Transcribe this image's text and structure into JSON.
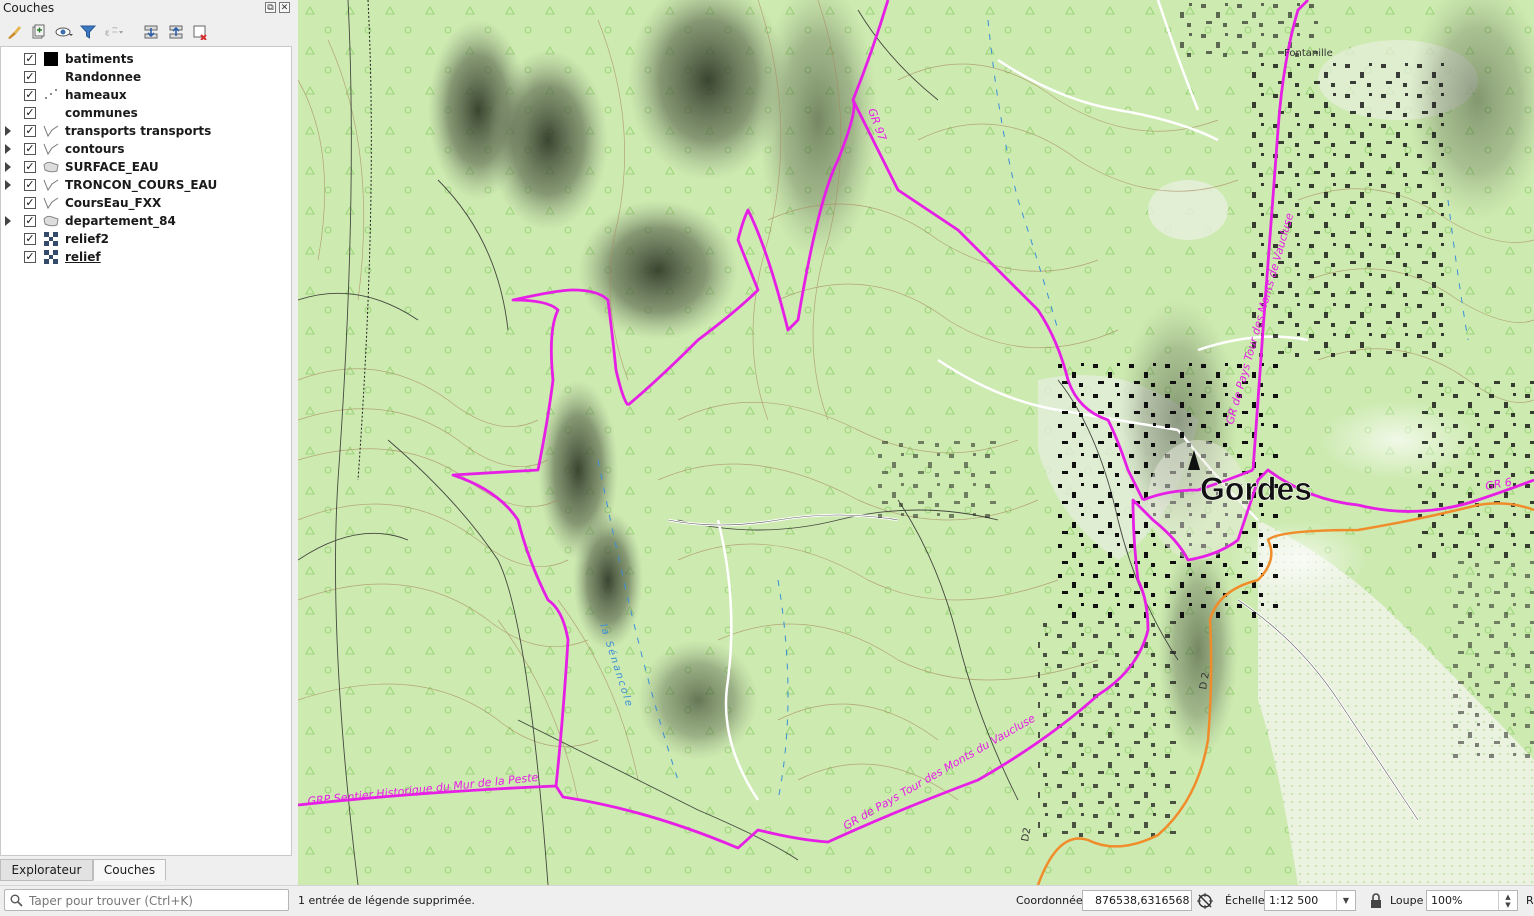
{
  "dock": {
    "title": "Couches",
    "float_glyph": "⧉",
    "close_glyph": "✕"
  },
  "toolbar": {
    "buttons": [
      "open-layer-styling-icon",
      "add-group-icon",
      "manage-map-themes-icon",
      "filter-legend-icon",
      "expression-filter-icon",
      "expand-all-icon",
      "collapse-all-icon",
      "remove-layer-icon"
    ]
  },
  "layers": [
    {
      "label": "batiments",
      "checked": true,
      "symbol": "fill-black",
      "expandable": false
    },
    {
      "label": "Randonnee",
      "checked": true,
      "symbol": "none",
      "expandable": false
    },
    {
      "label": "hameaux",
      "checked": true,
      "symbol": "points",
      "expandable": false
    },
    {
      "label": "communes",
      "checked": true,
      "symbol": "none",
      "expandable": false
    },
    {
      "label": "transports transports",
      "checked": true,
      "symbol": "line",
      "expandable": true
    },
    {
      "label": "contours",
      "checked": true,
      "symbol": "line",
      "expandable": true
    },
    {
      "label": "SURFACE_EAU",
      "checked": true,
      "symbol": "polygon",
      "expandable": true
    },
    {
      "label": "TRONCON_COURS_EAU",
      "checked": true,
      "symbol": "line",
      "expandable": true
    },
    {
      "label": "CoursEau_FXX",
      "checked": true,
      "symbol": "line",
      "expandable": false
    },
    {
      "label": "departement_84",
      "checked": true,
      "symbol": "polygon",
      "expandable": true
    },
    {
      "label": "relief2",
      "checked": true,
      "symbol": "raster",
      "expandable": false
    },
    {
      "label": "relief",
      "checked": true,
      "symbol": "raster",
      "expandable": false,
      "underlined": true
    }
  ],
  "tabs": {
    "explorer": "Explorateur",
    "layers": "Couches",
    "active": "layers"
  },
  "map": {
    "labels": {
      "town": "Gordes",
      "hamlet": "Fontanille",
      "trail_grp": "GRP Sentier Historique du Mur de la Peste",
      "trail_gr_pays": "GR de Pays Tour des Monts du Vaucluse",
      "trail_gr_pays_vertical": "GR de Pays Tour des Monts de Vaucluse",
      "trail_gr97": "GR 97",
      "trail_gr6": "GR 6",
      "road_d2": "D2",
      "road_d2_b": "D 2",
      "stream": "la Sénancole"
    },
    "colors": {
      "trail": "#e61ee6",
      "road": "#f08c2a",
      "background": "#cfeab3",
      "contour": "#a0825a",
      "stream": "#3a8fd8"
    }
  },
  "status": {
    "message": "1 entrée de légende supprimée.",
    "search_placeholder": "Taper pour trouver (Ctrl+K)",
    "coord_label": "Coordonnée",
    "coord_value": "876538,6316568",
    "scale_label": "Échelle",
    "scale_value": "1:12 500",
    "zoom_label": "Loupe",
    "zoom_value": "100%",
    "rotation_label": "R"
  }
}
